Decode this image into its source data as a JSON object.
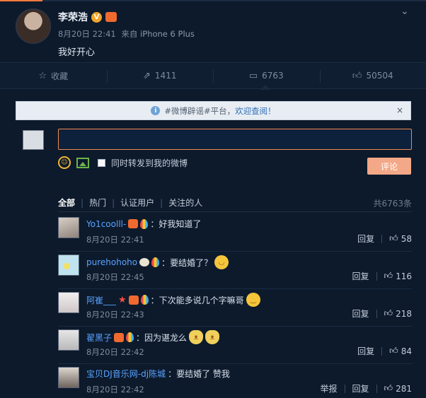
{
  "post": {
    "author": "李荣浩",
    "verified_badge": "V",
    "date": "8月20日 22:41",
    "from_label": "来自",
    "device": "iPhone 6 Plus",
    "text": "我好开心"
  },
  "actions": [
    {
      "icon": "star-icon",
      "label": "收藏"
    },
    {
      "icon": "repost-icon",
      "label": "1411"
    },
    {
      "icon": "comment-icon",
      "label": "6763"
    },
    {
      "icon": "thumb-up-icon",
      "label": "50504"
    }
  ],
  "notice": {
    "prefix": "#微博辟谣#平台，",
    "link": "欢迎查阅！",
    "close": "×"
  },
  "compose": {
    "input_value": "",
    "forward_label": "同时转发到我的微博",
    "submit_label": "评论"
  },
  "filters": {
    "tabs": [
      "全部",
      "热门",
      "认证用户",
      "关注的人"
    ],
    "total": "共6763条"
  },
  "comments": [
    {
      "user": "Yo1coolll-",
      "text": "：好我知道了",
      "time": "8月20日 22:41",
      "reply": "回复",
      "likes": "58",
      "emoji": ""
    },
    {
      "user": "purehohoho",
      "text": "：要结婚了？",
      "time": "8月20日 22:45",
      "reply": "回复",
      "likes": "116",
      "emoji": "blush"
    },
    {
      "user": "阿崔___",
      "text": "：下次能多说几个字嘛哥",
      "time": "8月20日 22:43",
      "reply": "回复",
      "likes": "218",
      "emoji": "smile"
    },
    {
      "user": "翟黑子",
      "text": "：因为谌龙么",
      "time": "8月20日 22:42",
      "reply": "回复",
      "likes": "84",
      "emoji": "cat"
    },
    {
      "user": "宝贝DJ音乐网-dj陈城",
      "text": "：要结婚了 赞我",
      "time": "8月20日 22:42",
      "reply": "回复",
      "report": "举报",
      "likes": "281",
      "emoji": ""
    }
  ],
  "colors": {
    "background": "#0c1a2c",
    "username": "#5aa3ff",
    "accent": "#f3a887"
  }
}
